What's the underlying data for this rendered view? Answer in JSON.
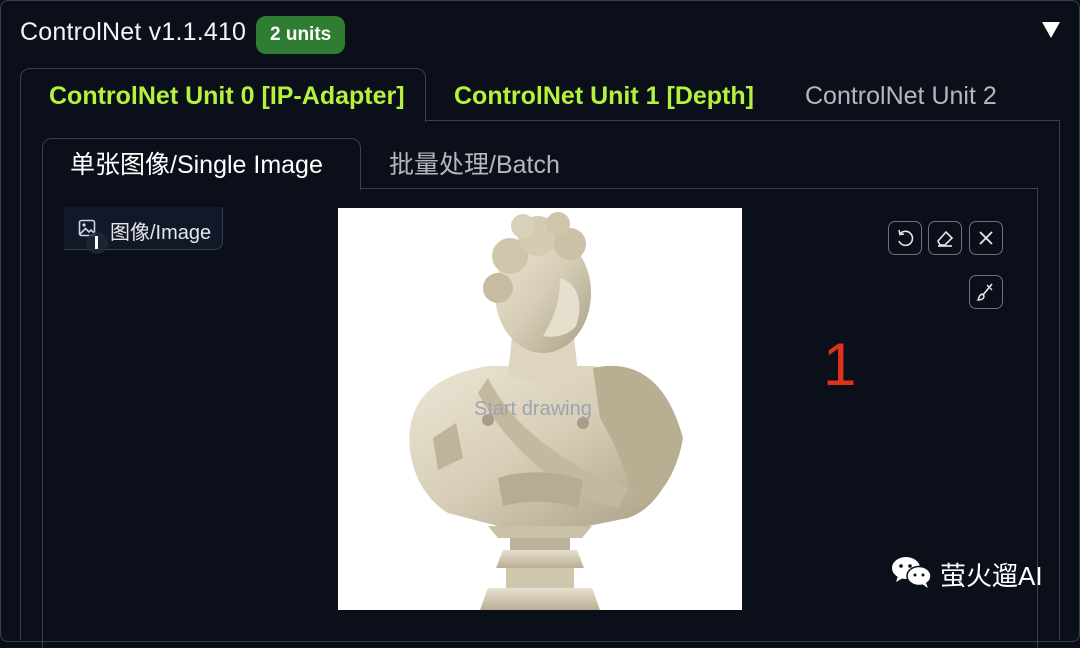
{
  "header": {
    "title": "ControlNet v1.1.410",
    "units_badge": "2 units"
  },
  "unit_tabs": [
    {
      "label": "ControlNet Unit 0 [IP-Adapter]",
      "state": "active"
    },
    {
      "label": "ControlNet Unit 1 [Depth]",
      "state": "enabled"
    },
    {
      "label": "ControlNet Unit 2",
      "state": "inactive"
    }
  ],
  "mode_tabs": [
    {
      "label": "单张图像/Single Image",
      "state": "active"
    },
    {
      "label": "批量处理/Batch",
      "state": "inactive"
    }
  ],
  "image_panel": {
    "label": "图像/Image",
    "canvas_hint": "Start drawing"
  },
  "toolbar_icons": [
    "undo-icon",
    "eraser-icon",
    "close-icon",
    "brush-icon"
  ],
  "annotation": "1",
  "watermark": "萤火遛AI",
  "colors": {
    "background": "#0b0f19",
    "active_tab": "#b5f23d",
    "badge": "#2f7d32",
    "annotation": "#e0311f"
  }
}
